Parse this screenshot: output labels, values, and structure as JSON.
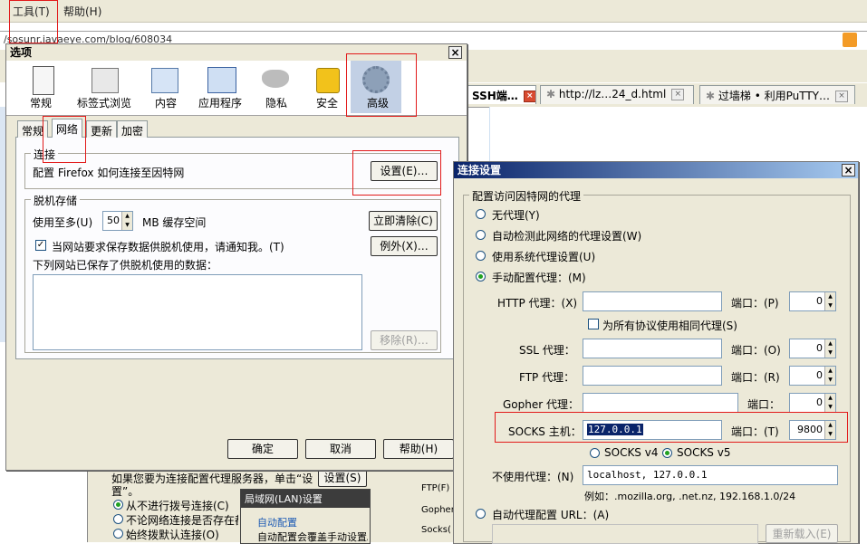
{
  "browser": {
    "menu_tools": "工具(T)",
    "menu_help": "帮助(H)",
    "address_url": "/sosunr.javaeye.com/blog/608034",
    "tabs": [
      {
        "label": "SSH端…"
      },
      {
        "label": "http://lz…24_d.html"
      },
      {
        "label": "过墙梯 • 利用PuTTY…"
      }
    ]
  },
  "options_dialog": {
    "title": "选项",
    "categories": [
      "常规",
      "标签式浏览",
      "内容",
      "应用程序",
      "隐私",
      "安全",
      "高级"
    ],
    "subtabs": [
      "常规",
      "网络",
      "更新",
      "加密"
    ],
    "connection": {
      "legend": "连接",
      "desc": "配置 Firefox 如何连接至因特网",
      "settings_btn": "设置(E)…"
    },
    "offline": {
      "legend": "脱机存储",
      "use_up_to": "使用至多(U)",
      "cache_value": "50",
      "cache_unit": "MB 缓存空间",
      "clear_now_btn": "立即清除(C)",
      "notify_label": "当网站要求保存数据供脱机使用，请通知我。(T)",
      "exceptions_btn": "例外(X)…",
      "saved_sites_label": "下列网站已保存了供脱机使用的数据：",
      "remove_btn": "移除(R)…"
    },
    "ok_btn": "确定",
    "cancel_btn": "取消",
    "help_btn": "帮助(H)"
  },
  "connection_dialog": {
    "title": "连接设置",
    "group_label": "配置访问因特网的代理",
    "no_proxy": "无代理(Y)",
    "auto_detect": "自动检测此网络的代理设置(W)",
    "system_proxy": "使用系统代理设置(U)",
    "manual_proxy": "手动配置代理：(M)",
    "http_label": "HTTP 代理：(X)",
    "http_value": "",
    "same_proxy_label": "为所有协议使用相同代理(S)",
    "ssl_label": "SSL 代理：",
    "ssl_value": "",
    "ftp_label": "FTP 代理：",
    "ftp_value": "",
    "gopher_label": "Gopher 代理：",
    "gopher_value": "",
    "socks_label": "SOCKS 主机：",
    "socks_value": "127.0.0.1",
    "port_label_p": "端口：(P)",
    "port_label_o": "端口：(O)",
    "port_label_r": "端口：(R)",
    "port_label_gopher": "端口：",
    "port_label_t": "端口：(T)",
    "http_port": "0",
    "ssl_port": "0",
    "ftp_port": "0",
    "gopher_port": "0",
    "socks_port": "9800",
    "socks_v4": "SOCKS v4",
    "socks_v5": "SOCKS v5",
    "no_proxy_for_label": "不使用代理：(N)",
    "no_proxy_for_value": "localhost, 127.0.0.1",
    "example": "例如：.mozilla.org, .net.nz, 192.168.1.0/24",
    "auto_config_label": "自动代理配置 URL：(A)",
    "reload_btn": "重新载入(E)"
  },
  "ie_background": {
    "text1": "如果您要为连接配置代理服务器，单击“设",
    "text2": "置”。",
    "settings_btn": "设置(S)",
    "opt1": "从不进行拨号连接(C)",
    "opt2": "不论网络连接是否存在都进",
    "opt3": "始终拨默认连接(O)",
    "lan_title": "局域网(LAN)设置",
    "lan_auto": "自动配置",
    "lan_auto_desc": "自动配置会覆盖手动设置。",
    "side_ftp": "FTP(F)",
    "side_gopher": "Gopher",
    "side_socks": "Socks(C"
  },
  "colors": {
    "dialog_bg": "#ece9d8",
    "highlight": "#0a246a",
    "annotation_red": "#e21a1a",
    "title_gradient_start": "#0a246a",
    "title_gradient_end": "#a6caf0"
  }
}
